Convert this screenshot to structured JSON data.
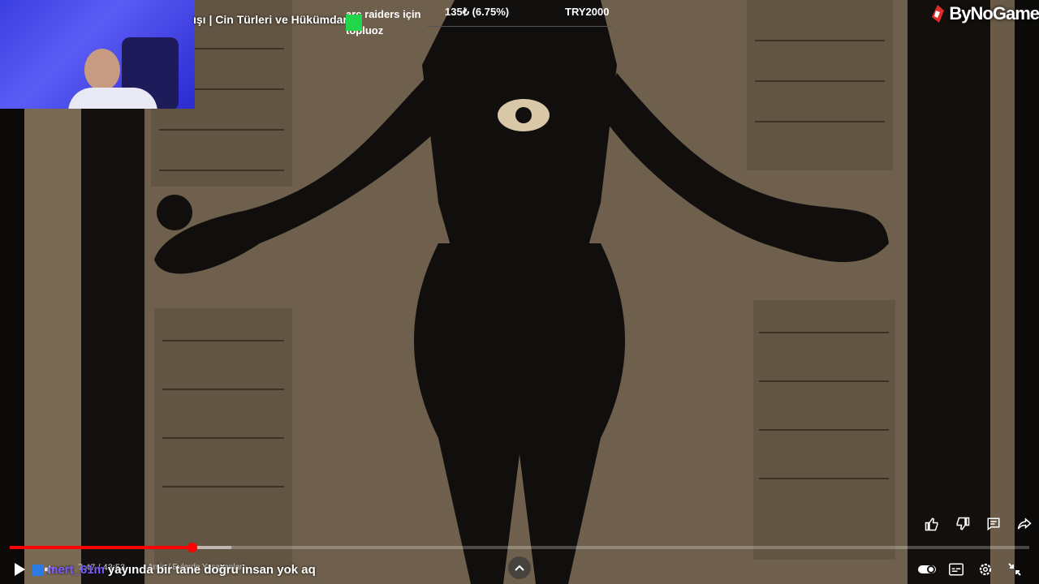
{
  "overlay": {
    "video_title": "ışı | Cin Türleri ve Hükümdar",
    "brand": "ByNoGame"
  },
  "donation": {
    "name_line1": "arc raiders için",
    "name_line2": "topluoz",
    "amount": "135₺ (6.75%)",
    "goal": "TRY2000"
  },
  "player": {
    "time": "7:47 / 43:53",
    "chapter": "Amis / Evlerde Yaşayanlar",
    "progress_percent": 17.9,
    "buffer_percent": 21.7
  },
  "chat": {
    "user": "mert_61m",
    "message": "yayında bir tane doğru insan yok aq"
  },
  "icons": [
    "play-icon",
    "volume-icon",
    "chevron-up-icon",
    "like-icon",
    "dislike-icon",
    "comment-icon",
    "share-icon",
    "autoplay-toggle-icon",
    "subtitles-icon",
    "settings-icon",
    "fullscreen-exit-icon"
  ],
  "colors": {
    "accent": "#ff0000",
    "donation_green": "#21d64a",
    "chat_user": "#7c5cff"
  }
}
